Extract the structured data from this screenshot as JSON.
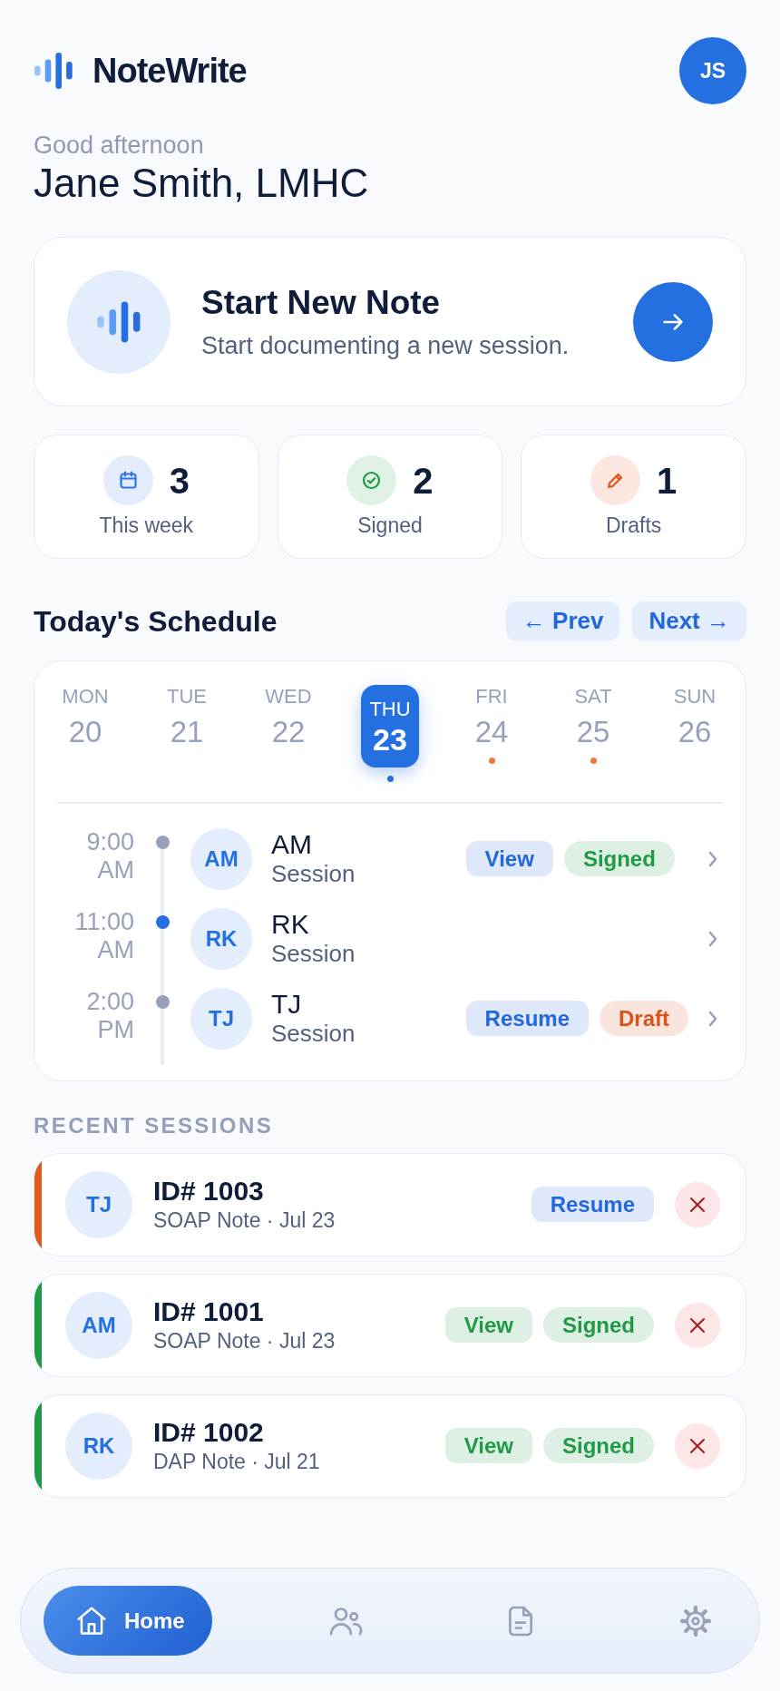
{
  "header": {
    "app_name": "NoteWrite",
    "user_initials": "JS"
  },
  "greeting": {
    "salutation": "Good afternoon",
    "name": "Jane Smith, LMHC"
  },
  "start_card": {
    "title": "Start New Note",
    "subtitle": "Start documenting a new session."
  },
  "stats": [
    {
      "value": "3",
      "label": "This week",
      "color": "#2f74e6"
    },
    {
      "value": "2",
      "label": "Signed",
      "color": "#1f9a47"
    },
    {
      "value": "1",
      "label": "Drafts",
      "color": "#e0551c"
    }
  ],
  "schedule": {
    "title": "Today's Schedule",
    "prev_label": "← Prev",
    "next_label": "Next →",
    "days": [
      {
        "weekday": "MON",
        "date": "20",
        "selected": false
      },
      {
        "weekday": "TUE",
        "date": "21",
        "selected": false
      },
      {
        "weekday": "WED",
        "date": "22",
        "selected": false
      },
      {
        "weekday": "THU",
        "date": "23",
        "selected": true,
        "color": "#2470e0"
      },
      {
        "weekday": "FRI",
        "date": "24",
        "selected": false,
        "color": "#f97342"
      },
      {
        "weekday": "SAT",
        "date": "25",
        "selected": false,
        "color": "#f97342"
      },
      {
        "weekday": "SUN",
        "date": "26",
        "selected": false
      }
    ],
    "appointments": [
      {
        "time": "9:00 AM",
        "initials": "AM",
        "name": "AM",
        "type": "Session",
        "current": false,
        "actions": [
          {
            "label": "View",
            "kind": "button",
            "color": "#2267de"
          },
          {
            "label": "Signed",
            "kind": "status",
            "color": "#1f9a47"
          }
        ]
      },
      {
        "time": "11:00 AM",
        "initials": "RK",
        "name": "RK",
        "type": "Session",
        "current": true
      },
      {
        "time": "2:00 PM",
        "initials": "TJ",
        "name": "TJ",
        "type": "Session",
        "current": false,
        "actions": [
          {
            "label": "Resume",
            "kind": "button",
            "color": "#2267de"
          },
          {
            "label": "Draft",
            "kind": "status",
            "color": "#d9531a"
          }
        ]
      }
    ]
  },
  "recent_sessions": {
    "title": "RECENT SESSIONS",
    "items": [
      {
        "initials": "TJ",
        "title": "ID# 1003",
        "details": "SOAP Note · Jul 23",
        "color": "#e05a1e",
        "actions": [
          {
            "label": "Resume",
            "kind": "button",
            "color": "#2267de"
          }
        ]
      },
      {
        "initials": "AM",
        "title": "ID# 1001",
        "details": "SOAP Note · Jul 23",
        "color": "#1f9a47",
        "actions": [
          {
            "label": "View",
            "kind": "button",
            "color": "#1f9a47"
          },
          {
            "label": "Signed",
            "kind": "status",
            "color": "#1f9a47"
          }
        ]
      },
      {
        "initials": "RK",
        "title": "ID# 1002",
        "details": "DAP Note · Jul 21",
        "color": "#1f9a47",
        "actions": [
          {
            "label": "View",
            "kind": "button",
            "color": "#1f9a47"
          },
          {
            "label": "Signed",
            "kind": "status",
            "color": "#1f9a47"
          }
        ]
      }
    ]
  },
  "nav": [
    {
      "label": "Home",
      "selected": true
    },
    {
      "selected": false
    },
    {
      "selected": false
    },
    {
      "selected": false
    }
  ]
}
